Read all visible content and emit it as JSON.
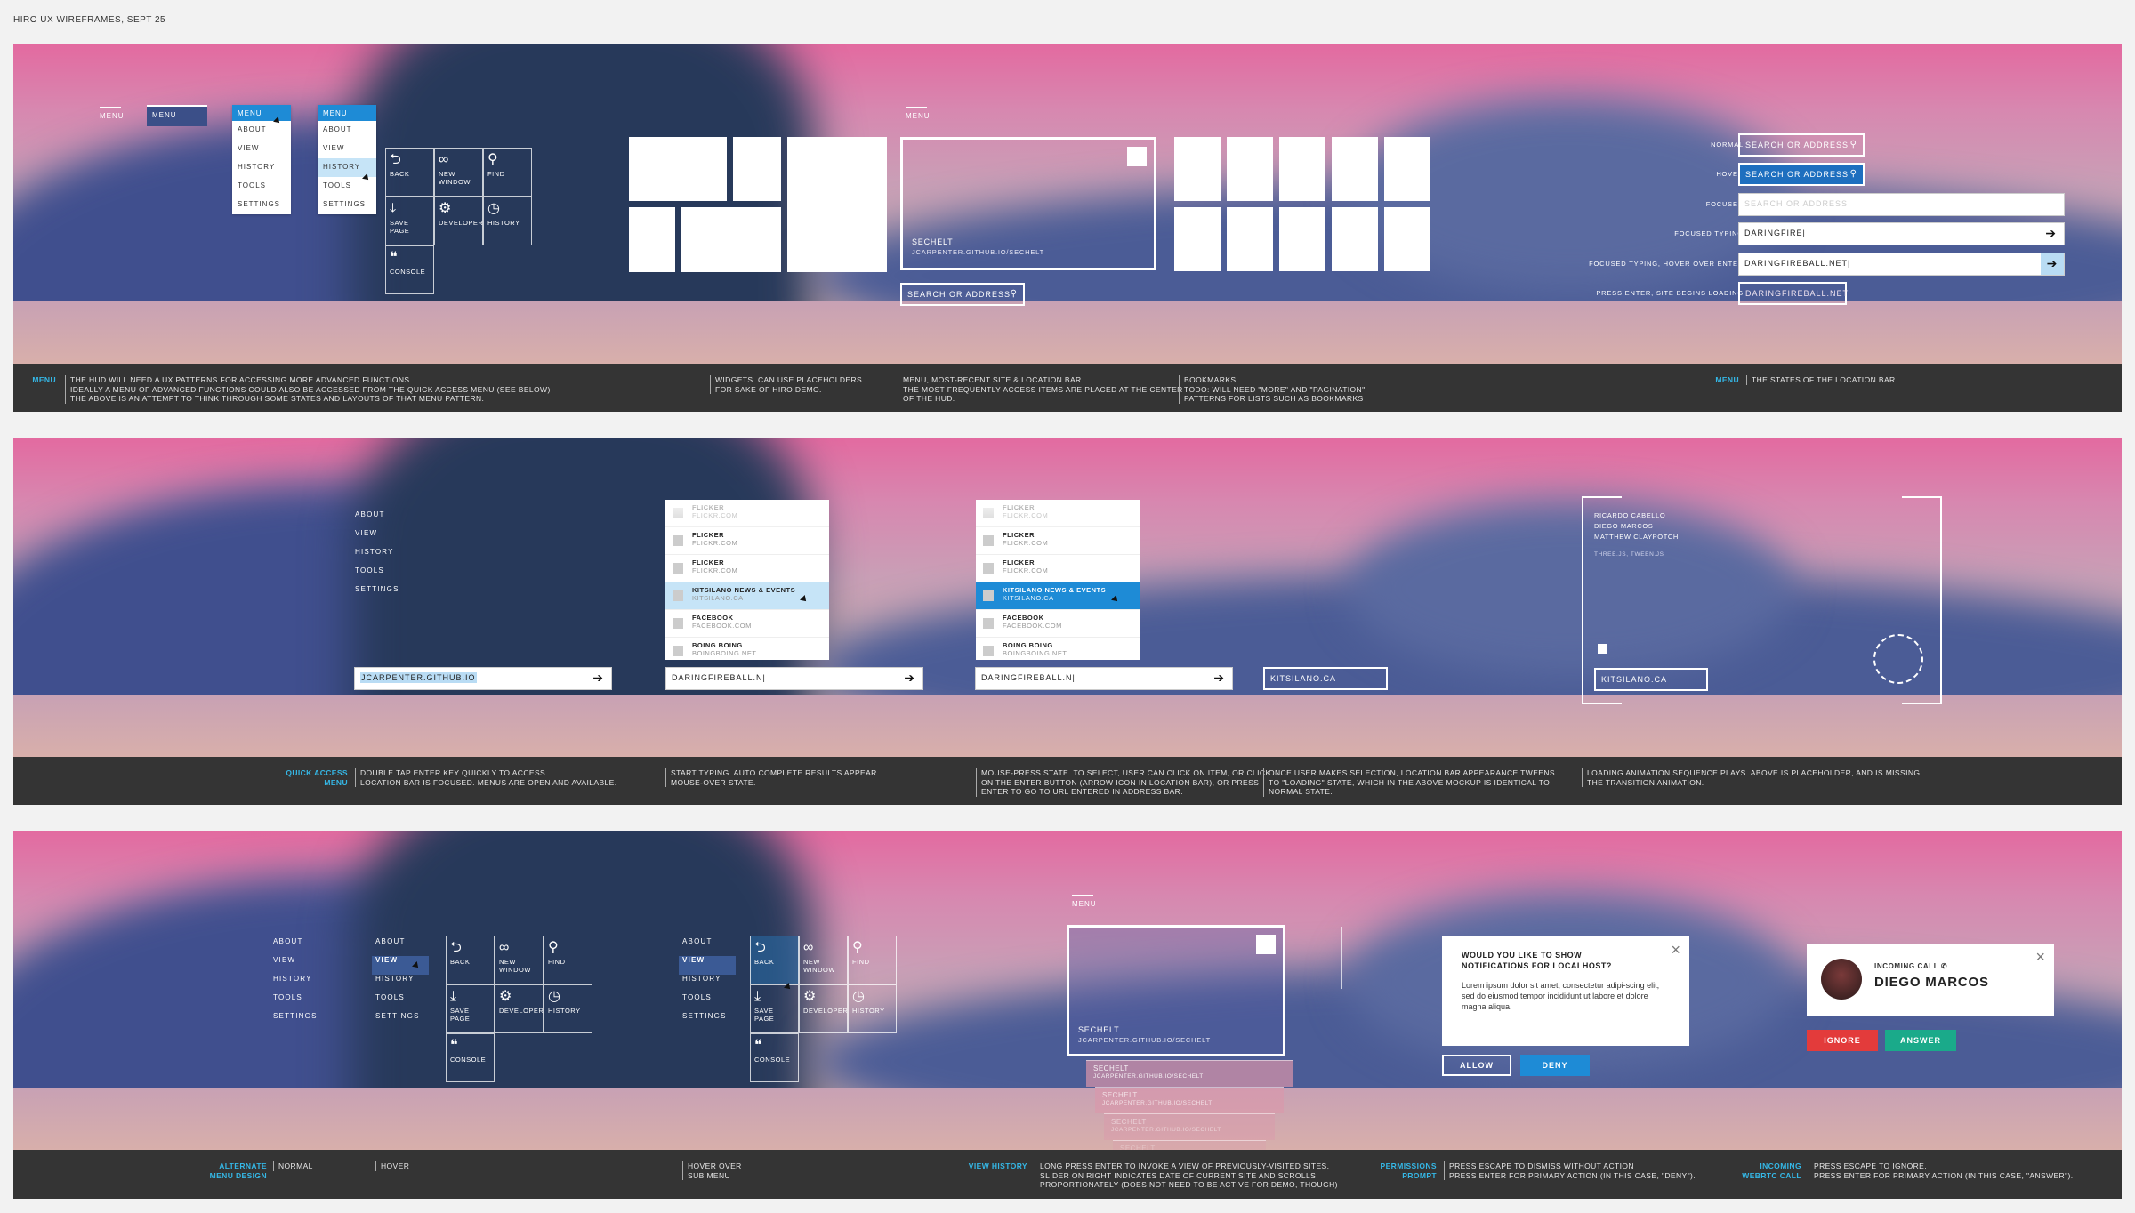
{
  "page_title": "HIRO UX WIREFRAMES, SEPT 25",
  "row1": {
    "menu_states": {
      "tab": "MENU",
      "items": [
        "ABOUT",
        "VIEW",
        "HISTORY",
        "TOOLS",
        "SETTINGS"
      ]
    },
    "quick_grid": [
      {
        "icon": "back-icon",
        "glyph": "⮌",
        "label": "BACK"
      },
      {
        "icon": "glasses-icon",
        "glyph": "∞",
        "label": "NEW WINDOW"
      },
      {
        "icon": "find-icon",
        "glyph": "⚲",
        "label": "FIND"
      },
      {
        "icon": "download-icon",
        "glyph": "⤓",
        "label": "SAVE PAGE"
      },
      {
        "icon": "gear-icon",
        "glyph": "⚙",
        "label": "DEVELOPER"
      },
      {
        "icon": "clock-icon",
        "glyph": "◷",
        "label": "HISTORY"
      },
      {
        "icon": "quote-icon",
        "glyph": "❝",
        "label": "CONSOLE"
      }
    ],
    "center_menu_tab": "MENU",
    "recent_site": {
      "title": "SECHELT",
      "url": "JCARPENTER.GITHUB.IO/SECHELT"
    },
    "location_placeholder": "SEARCH OR ADDRESS",
    "states": [
      {
        "label": "NORMAL",
        "value": "SEARCH OR ADDRESS"
      },
      {
        "label": "HOVER",
        "value": "SEARCH OR ADDRESS"
      },
      {
        "label": "FOCUSED",
        "value": "SEARCH OR ADDRESS"
      },
      {
        "label": "FOCUSED TYPING",
        "value": "DARINGFIRE"
      },
      {
        "label": "FOCUSED TYPING, HOVER OVER ENTER",
        "value": "DARINGFIREBALL.NET"
      },
      {
        "label": "PRESS ENTER, SITE BEGINS LOADING",
        "value": "DARINGFIREBALL.NET"
      }
    ],
    "footer": {
      "head1": "MENU",
      "text1": "THE HUD WILL NEED A UX PATTERNS FOR ACCESSING MORE ADVANCED FUNCTIONS.\nIDEALLY A MENU OF ADVANCED FUNCTIONS COULD ALSO BE ACCESSED FROM THE QUICK ACCESS MENU (SEE BELOW)\nTHE ABOVE IS AN ATTEMPT TO THINK THROUGH SOME STATES AND LAYOUTS OF THAT MENU PATTERN.",
      "text2": "WIDGETS. CAN USE PLACEHOLDERS\nFOR SAKE OF HIRO DEMO.",
      "text3": "MENU, MOST-RECENT SITE & LOCATION BAR\nTHE MOST FREQUENTLY ACCESS ITEMS ARE PLACED AT THE CENTER\nOF THE HUD.",
      "text4": "BOOKMARKS.\nTODO: WILL NEED \"MORE\" AND \"PAGINATION\"\nPATTERNS FOR LISTS SUCH AS BOOKMARKS",
      "head5": "MENU",
      "text5": "THE STATES OF THE LOCATION BAR"
    }
  },
  "row2": {
    "side_items": [
      "ABOUT",
      "VIEW",
      "HISTORY",
      "TOOLS",
      "SETTINGS"
    ],
    "address1": "JCARPENTER.GITHUB.IO",
    "results": [
      {
        "title": "FLICKER",
        "url": "FLICKR.COM"
      },
      {
        "title": "FLICKER",
        "url": "FLICKR.COM"
      },
      {
        "title": "FLICKER",
        "url": "FLICKR.COM"
      },
      {
        "title": "KITSILANO NEWS & EVENTS",
        "url": "KITSILANO.CA"
      },
      {
        "title": "FACEBOOK",
        "url": "FACEBOOK.COM"
      },
      {
        "title": "BOING BOING",
        "url": "BOINGBOING.NET"
      }
    ],
    "address2": "DARINGFIREBALL.N",
    "address3": "DARINGFIREBALL.N",
    "address4": "KITSILANO.CA",
    "loader": {
      "names": [
        "RICARDO CABELLO",
        "DIEGO MARCOS",
        "MATTHEW CLAYPOTCH"
      ],
      "meta": "THREE.JS, TWEEN.JS",
      "address": "KITSILANO.CA"
    },
    "footer": {
      "head1": "QUICK ACCESS\nMENU",
      "text1": "DOUBLE TAP ENTER KEY QUICKLY TO ACCESS.\nLOCATION BAR IS FOCUSED. MENUS ARE OPEN AND AVAILABLE.",
      "text2": "START TYPING. AUTO COMPLETE RESULTS APPEAR.\nMOUSE-OVER STATE.",
      "text3": "MOUSE-PRESS STATE. TO SELECT, USER CAN CLICK ON ITEM, OR CLICK\nON THE ENTER BUTTON (ARROW ICON IN LOCATION BAR), OR PRESS\nENTER TO GO TO URL ENTERED IN ADDRESS BAR.",
      "text4": "ONCE USER MAKES SELECTION, LOCATION BAR APPEARANCE TWEENS\nTO \"LOADING\" STATE, WHICH IN THE ABOVE MOCKUP IS IDENTICAL TO\nNORMAL STATE.",
      "text5": "LOADING ANIMATION SEQUENCE PLAYS. ABOVE IS PLACEHOLDER, AND IS MISSING\nTHE TRANSITION ANIMATION."
    }
  },
  "row3": {
    "side_items": [
      "ABOUT",
      "VIEW",
      "HISTORY",
      "TOOLS",
      "SETTINGS"
    ],
    "menu_tab": "MENU",
    "history_site": {
      "title": "SECHELT",
      "url": "JCARPENTER.GITHUB.IO/SECHELT"
    },
    "stack_item": "SECHELT",
    "stack_url": "JCARPENTER.GITHUB.IO/SECHELT",
    "prompt": {
      "title": "WOULD YOU LIKE TO SHOW NOTIFICATIONS FOR LOCALHOST?",
      "body": "Lorem ipsum dolor sit amet, consectetur adipi-scing elit, sed do eiusmod tempor incididunt ut labore et dolore magna aliqua.",
      "allow": "ALLOW",
      "deny": "DENY"
    },
    "call": {
      "label": "INCOMING CALL",
      "name": "DIEGO MARCOS",
      "ignore": "IGNORE",
      "answer": "ANSWER"
    },
    "footer": {
      "head1": "ALTERNATE\nMENU DESIGN",
      "text1": "NORMAL",
      "text2": "HOVER",
      "text3": "HOVER OVER\nSUB MENU",
      "head4": "VIEW HISTORY",
      "text4": "LONG PRESS ENTER TO INVOKE A VIEW OF PREVIOUSLY-VISITED SITES.\nSLIDER ON RIGHT INDICATES DATE OF CURRENT SITE AND SCROLLS\nPROPORTIONATELY (DOES NOT NEED TO BE ACTIVE FOR DEMO, THOUGH)",
      "head5": "PERMISSIONS\nPROMPT",
      "text5": "PRESS ESCAPE TO DISMISS WITHOUT ACTION\nPRESS ENTER FOR PRIMARY ACTION (IN THIS CASE, \"DENY\").",
      "head6": "INCOMING\nWEBRTC CALL",
      "text6": "PRESS ESCAPE TO IGNORE.\nPRESS ENTER FOR PRIMARY ACTION (IN THIS CASE, \"ANSWER\")."
    }
  },
  "colors": {
    "accent": "#1e8bd6",
    "footer": "#343434",
    "cyan": "#35b7e6",
    "deny": "#1e8bd6",
    "ignore": "#e33b3b",
    "answer": "#1aaa8a"
  }
}
